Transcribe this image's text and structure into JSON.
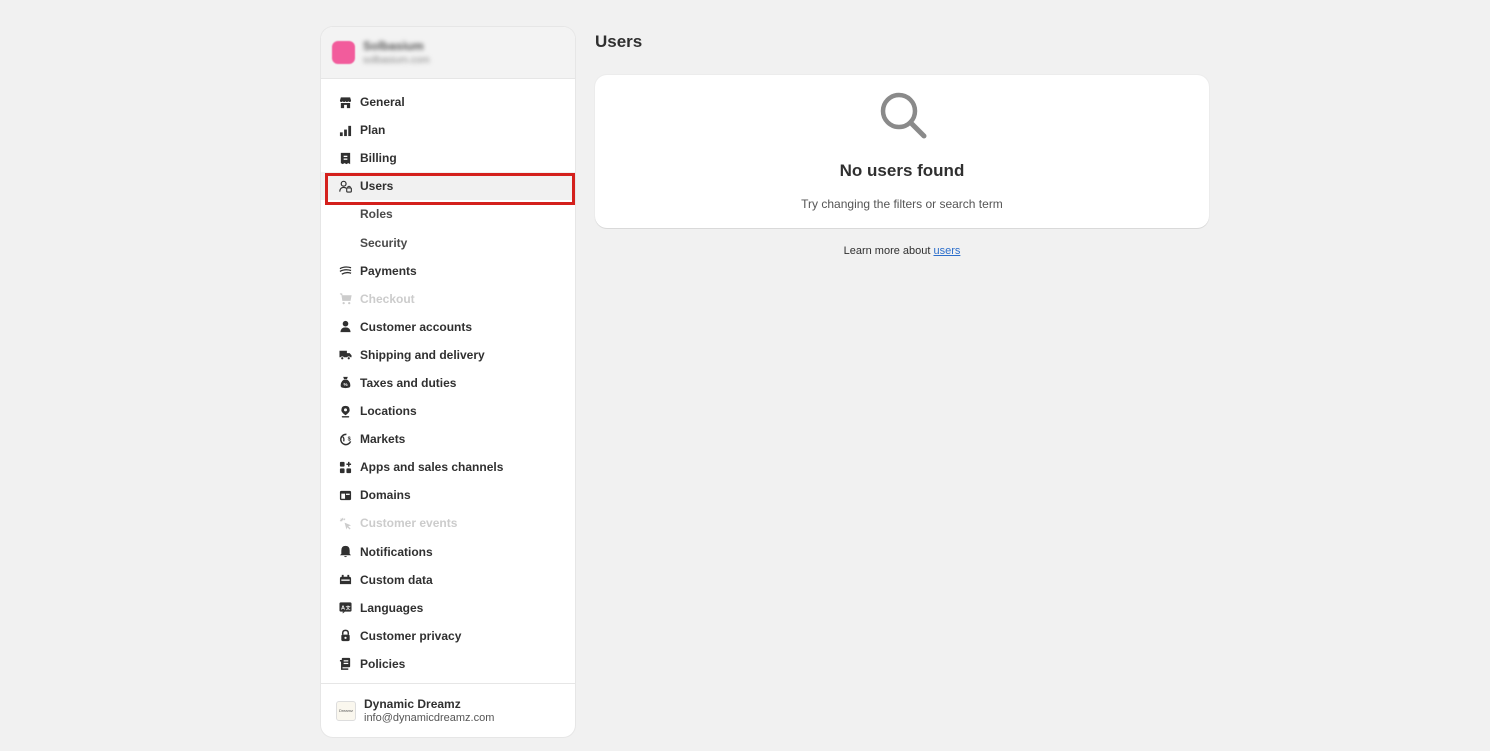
{
  "store": {
    "name": "Solbasium",
    "url": "solbasium.com",
    "avatar_color": "#f25c9c"
  },
  "sidebar": {
    "items": [
      {
        "label": "General",
        "icon": "store-icon"
      },
      {
        "label": "Plan",
        "icon": "plan-chart-icon"
      },
      {
        "label": "Billing",
        "icon": "billing-receipt-icon"
      },
      {
        "label": "Users",
        "icon": "users-icon",
        "selected": true
      },
      {
        "label": "Roles",
        "sub": true
      },
      {
        "label": "Security",
        "sub": true
      },
      {
        "label": "Payments",
        "icon": "payments-icon"
      },
      {
        "label": "Checkout",
        "icon": "cart-icon",
        "disabled": true
      },
      {
        "label": "Customer accounts",
        "icon": "person-icon"
      },
      {
        "label": "Shipping and delivery",
        "icon": "truck-icon"
      },
      {
        "label": "Taxes and duties",
        "icon": "tax-bag-icon"
      },
      {
        "label": "Locations",
        "icon": "location-pin-icon"
      },
      {
        "label": "Markets",
        "icon": "globe-icon"
      },
      {
        "label": "Apps and sales channels",
        "icon": "apps-icon"
      },
      {
        "label": "Domains",
        "icon": "domain-icon"
      },
      {
        "label": "Customer events",
        "icon": "cursor-click-icon",
        "disabled": true
      },
      {
        "label": "Notifications",
        "icon": "bell-icon"
      },
      {
        "label": "Custom data",
        "icon": "custom-data-icon"
      },
      {
        "label": "Languages",
        "icon": "language-icon"
      },
      {
        "label": "Customer privacy",
        "icon": "lock-icon"
      },
      {
        "label": "Policies",
        "icon": "policy-icon"
      }
    ],
    "footer": {
      "name": "Dynamic Dreamz",
      "email": "info@dynamicdreamz.com",
      "logo_text": "Dreamz"
    }
  },
  "main": {
    "title": "Users",
    "empty_state": {
      "icon": "search-icon",
      "title": "No users found",
      "subtitle": "Try changing the filters or search term"
    },
    "learn_more": {
      "prefix": "Learn more about ",
      "link": "users"
    }
  },
  "colors": {
    "background": "#f1f1f1",
    "highlight": "#d4201c",
    "link": "#2c6ecb"
  }
}
